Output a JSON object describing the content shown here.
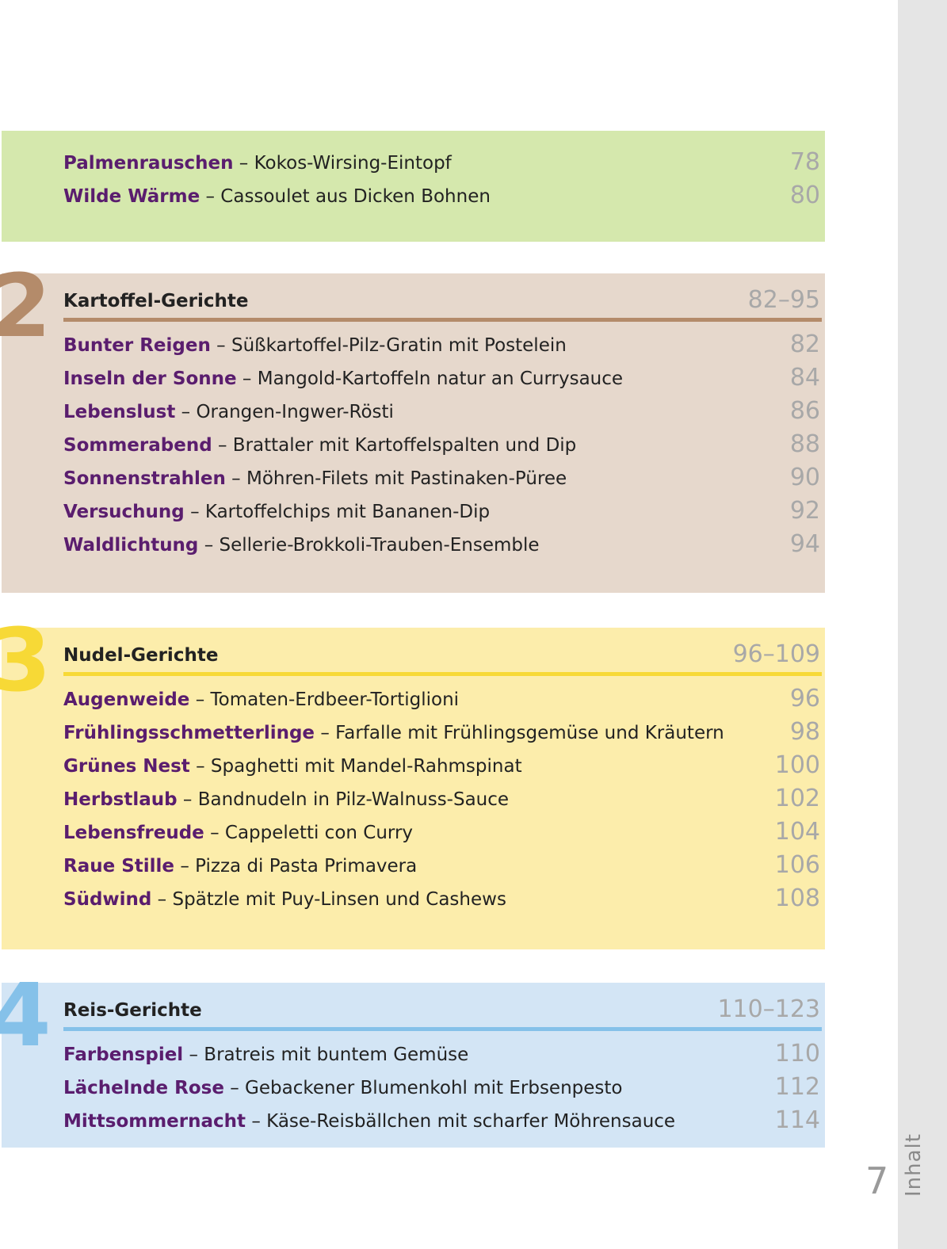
{
  "sidebar": {
    "label": "Inhalt",
    "page_number": "7"
  },
  "sections": [
    {
      "number": "",
      "title": "",
      "range": "",
      "bg": "#d5e8ad",
      "accent": "#d5e8ad",
      "entries": [
        {
          "name": "Palmenrauschen",
          "desc": " – Kokos-Wirsing-Eintopf",
          "page": "78"
        },
        {
          "name": "Wilde Wärme",
          "desc": " – Cassoulet aus Dicken Bohnen",
          "page": "80"
        }
      ]
    },
    {
      "number": "2",
      "title": "Kartoffel-Gerichte",
      "range": "82–95",
      "bg": "#e6d8cc",
      "accent": "#b48b6a",
      "entries": [
        {
          "name": "Bunter Reigen",
          "desc": " – Süßkartoffel-Pilz-Gratin mit Postelein",
          "page": "82"
        },
        {
          "name": "Inseln der Sonne",
          "desc": " – Mangold-Kartoffeln natur an Currysauce",
          "page": "84"
        },
        {
          "name": "Lebenslust",
          "desc": " – Orangen-Ingwer-Rösti",
          "page": "86"
        },
        {
          "name": "Sommerabend",
          "desc": " – Brattaler mit Kartoffelspalten und Dip",
          "page": "88"
        },
        {
          "name": "Sonnenstrahlen",
          "desc": " – Möhren-Filets mit Pastinaken-Püree",
          "page": "90"
        },
        {
          "name": "Versuchung",
          "desc": " – Kartoffelchips mit Bananen-Dip",
          "page": "92"
        },
        {
          "name": "Waldlichtung",
          "desc": " – Sellerie-Brokkoli-Trauben-Ensemble",
          "page": "94"
        }
      ]
    },
    {
      "number": "3",
      "title": "Nudel-Gerichte",
      "range": "96–109",
      "bg": "#fcedab",
      "accent": "#f7d936",
      "entries": [
        {
          "name": "Augenweide",
          "desc": " – Tomaten-Erdbeer-Tortiglioni",
          "page": "96"
        },
        {
          "name": "Frühlingsschmetterlinge",
          "desc": " – Farfalle mit Frühlingsgemüse und Kräutern",
          "page": "98"
        },
        {
          "name": "Grünes Nest",
          "desc": " – Spaghetti mit Mandel-Rahmspinat",
          "page": "100"
        },
        {
          "name": "Herbstlaub",
          "desc": " – Bandnudeln in Pilz-Walnuss-Sauce",
          "page": "102"
        },
        {
          "name": "Lebensfreude",
          "desc": " – Cappeletti con Curry",
          "page": "104"
        },
        {
          "name": "Raue Stille",
          "desc": " – Pizza di Pasta Primavera",
          "page": "106"
        },
        {
          "name": "Südwind",
          "desc": " – Spätzle mit Puy-Linsen und Cashews",
          "page": "108"
        }
      ]
    },
    {
      "number": "4",
      "title": "Reis-Gerichte",
      "range": "110–123",
      "bg": "#d3e5f5",
      "accent": "#85c1e9",
      "entries": [
        {
          "name": "Farbenspiel",
          "desc": " – Bratreis mit buntem Gemüse",
          "page": "110"
        },
        {
          "name": "Lächelnde Rose",
          "desc": " – Gebackener Blumenkohl mit Erbsenpesto",
          "page": "112"
        },
        {
          "name": "Mittsommernacht",
          "desc": " – Käse-Reisbällchen mit scharfer Möhrensauce",
          "page": "114"
        }
      ]
    }
  ]
}
